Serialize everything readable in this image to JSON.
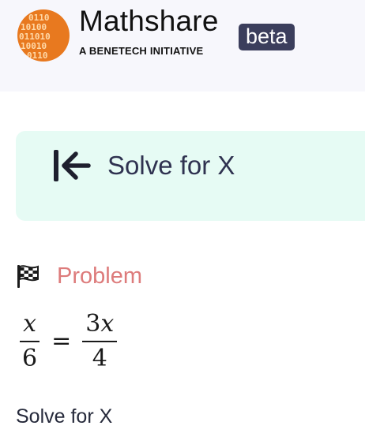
{
  "header": {
    "brand_name": "Mathshare",
    "tagline": "A BENETECH INITIATIVE",
    "beta_label": "beta",
    "logo_icon": "binary-digits-circle-icon",
    "colors": {
      "header_bg": "#f7f7fc",
      "logo_orange": "#e8791f",
      "beta_bg": "#3b3e5c"
    }
  },
  "title_banner": {
    "back_icon": "arrow-left-to-bar-icon",
    "title": "Solve for X",
    "bg_color": "#e6fbf4"
  },
  "problem": {
    "flag_icon": "checkered-flag-icon",
    "label": "Problem",
    "label_color": "#dd7b7b",
    "equation": {
      "left": {
        "numerator": "x",
        "denominator": "6"
      },
      "operator": "=",
      "right": {
        "numerator_coefficient": "3",
        "numerator_variable": "x",
        "denominator": "4"
      }
    },
    "text": "Solve for X"
  }
}
